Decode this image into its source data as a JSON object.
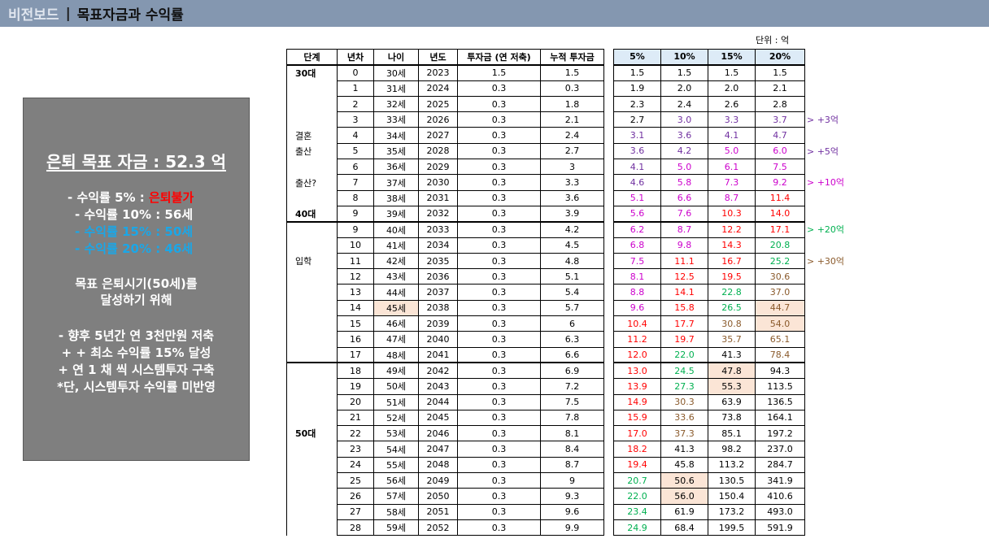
{
  "header": {
    "subtitle": "비전보드",
    "separator": "|",
    "title": "목표자금과 수익률"
  },
  "goal": {
    "title": "은퇴 목표 자금 : 52.3 억",
    "rates": [
      {
        "prefix": "- 수익률 5% : ",
        "value": "은퇴불가",
        "color": "red"
      },
      {
        "prefix": "- 수익률 10% : ",
        "value": "56세",
        "color": "white"
      },
      {
        "prefix": "- 수익률 15% : ",
        "value": "50세",
        "color": "blue"
      },
      {
        "prefix": "- 수익률 20% : ",
        "value": "46세",
        "color": "blue"
      }
    ],
    "target_line1": "목표 은퇴시기(50세)를",
    "target_line2": "달성하기 위해",
    "plan": [
      "- 향후 5년간 연 3천만원 저축",
      "+ + 최소 수익률 15% 달성",
      "+ 연 1 채 씩 시스템투자 구축",
      "*단, 시스템투자 수익률 미반영"
    ]
  },
  "unit": "단위 : 억",
  "colors": {
    "purple": "#7030a0",
    "magenta": "#cc00cc",
    "red": "#ff0000",
    "green": "#00b050",
    "brown": "#8a5a2b",
    "black": "#000000",
    "highlight": "#fbe5d6"
  },
  "table": {
    "headers": [
      "단계",
      "년차",
      "나이",
      "년도",
      "투자금 (연 저축)",
      "누적 투자금"
    ],
    "rate_headers": [
      "5%",
      "10%",
      "15%",
      "20%"
    ],
    "stages": [
      {
        "label": "30대",
        "row": 0,
        "bold": true
      },
      {
        "label": "결혼",
        "row": 4,
        "bold": false
      },
      {
        "label": "출산",
        "row": 5,
        "bold": false
      },
      {
        "label": "출산?",
        "row": 7,
        "bold": false
      },
      {
        "label": "40대",
        "row": 9,
        "bold": true
      },
      {
        "label": "입학",
        "row": 12,
        "bold": false
      },
      {
        "label": "50대",
        "row": 23,
        "bold": true
      }
    ],
    "rows": [
      {
        "year": "0",
        "age": "30세",
        "calyear": "2023",
        "invest": "1.5",
        "cum": "1.5",
        "r": [
          "1.5",
          "1.5",
          "1.5",
          "1.5"
        ],
        "c": [
          "black",
          "black",
          "black",
          "black"
        ]
      },
      {
        "year": "1",
        "age": "31세",
        "calyear": "2024",
        "invest": "0.3",
        "cum": "0.3",
        "r": [
          "1.9",
          "2.0",
          "2.0",
          "2.1"
        ],
        "c": [
          "black",
          "black",
          "black",
          "black"
        ]
      },
      {
        "year": "2",
        "age": "32세",
        "calyear": "2025",
        "invest": "0.3",
        "cum": "1.8",
        "r": [
          "2.3",
          "2.4",
          "2.6",
          "2.8"
        ],
        "c": [
          "black",
          "black",
          "black",
          "black"
        ]
      },
      {
        "year": "3",
        "age": "33세",
        "calyear": "2026",
        "invest": "0.3",
        "cum": "2.1",
        "r": [
          "2.7",
          "3.0",
          "3.3",
          "3.7"
        ],
        "c": [
          "black",
          "purple",
          "purple",
          "purple"
        ]
      },
      {
        "year": "4",
        "age": "34세",
        "calyear": "2027",
        "invest": "0.3",
        "cum": "2.4",
        "r": [
          "3.1",
          "3.6",
          "4.1",
          "4.7"
        ],
        "c": [
          "purple",
          "purple",
          "purple",
          "purple"
        ]
      },
      {
        "year": "5",
        "age": "35세",
        "calyear": "2028",
        "invest": "0.3",
        "cum": "2.7",
        "r": [
          "3.6",
          "4.2",
          "5.0",
          "6.0"
        ],
        "c": [
          "purple",
          "purple",
          "magenta",
          "magenta"
        ]
      },
      {
        "year": "6",
        "age": "36세",
        "calyear": "2029",
        "invest": "0.3",
        "cum": "3",
        "r": [
          "4.1",
          "5.0",
          "6.1",
          "7.5"
        ],
        "c": [
          "purple",
          "magenta",
          "magenta",
          "magenta"
        ]
      },
      {
        "year": "7",
        "age": "37세",
        "calyear": "2030",
        "invest": "0.3",
        "cum": "3.3",
        "r": [
          "4.6",
          "5.8",
          "7.3",
          "9.2"
        ],
        "c": [
          "purple",
          "magenta",
          "magenta",
          "magenta"
        ]
      },
      {
        "year": "8",
        "age": "38세",
        "calyear": "2031",
        "invest": "0.3",
        "cum": "3.6",
        "r": [
          "5.1",
          "6.6",
          "8.7",
          "11.4"
        ],
        "c": [
          "magenta",
          "magenta",
          "magenta",
          "red"
        ]
      },
      {
        "year": "9",
        "age": "39세",
        "calyear": "2032",
        "invest": "0.3",
        "cum": "3.9",
        "r": [
          "5.6",
          "7.6",
          "10.3",
          "14.0"
        ],
        "c": [
          "magenta",
          "magenta",
          "red",
          "red"
        ]
      },
      {
        "year": "9",
        "age": "40세",
        "calyear": "2033",
        "invest": "0.3",
        "cum": "4.2",
        "r": [
          "6.2",
          "8.7",
          "12.2",
          "17.1"
        ],
        "c": [
          "magenta",
          "magenta",
          "red",
          "red"
        ]
      },
      {
        "year": "10",
        "age": "41세",
        "calyear": "2034",
        "invest": "0.3",
        "cum": "4.5",
        "r": [
          "6.8",
          "9.8",
          "14.3",
          "20.8"
        ],
        "c": [
          "magenta",
          "magenta",
          "red",
          "green"
        ]
      },
      {
        "year": "11",
        "age": "42세",
        "calyear": "2035",
        "invest": "0.3",
        "cum": "4.8",
        "r": [
          "7.5",
          "11.1",
          "16.7",
          "25.2"
        ],
        "c": [
          "magenta",
          "red",
          "red",
          "green"
        ]
      },
      {
        "year": "12",
        "age": "43세",
        "calyear": "2036",
        "invest": "0.3",
        "cum": "5.1",
        "r": [
          "8.1",
          "12.5",
          "19.5",
          "30.6"
        ],
        "c": [
          "magenta",
          "red",
          "red",
          "brown"
        ]
      },
      {
        "year": "13",
        "age": "44세",
        "calyear": "2037",
        "invest": "0.3",
        "cum": "5.4",
        "r": [
          "8.8",
          "14.1",
          "22.8",
          "37.0"
        ],
        "c": [
          "magenta",
          "red",
          "green",
          "brown"
        ]
      },
      {
        "year": "14",
        "age": "45세",
        "calyear": "2038",
        "invest": "0.3",
        "cum": "5.7",
        "r": [
          "9.6",
          "15.8",
          "26.5",
          "44.7"
        ],
        "c": [
          "magenta",
          "red",
          "green",
          "brown"
        ]
      },
      {
        "year": "15",
        "age": "46세",
        "calyear": "2039",
        "invest": "0.3",
        "cum": "6",
        "r": [
          "10.4",
          "17.7",
          "30.8",
          "54.0"
        ],
        "c": [
          "red",
          "red",
          "brown",
          "brown"
        ]
      },
      {
        "year": "16",
        "age": "47세",
        "calyear": "2040",
        "invest": "0.3",
        "cum": "6.3",
        "r": [
          "11.2",
          "19.7",
          "35.7",
          "65.1"
        ],
        "c": [
          "red",
          "red",
          "brown",
          "brown"
        ]
      },
      {
        "year": "17",
        "age": "48세",
        "calyear": "2041",
        "invest": "0.3",
        "cum": "6.6",
        "r": [
          "12.0",
          "22.0",
          "41.3",
          "78.4"
        ],
        "c": [
          "red",
          "green",
          "black",
          "brown"
        ]
      },
      {
        "year": "18",
        "age": "49세",
        "calyear": "2042",
        "invest": "0.3",
        "cum": "6.9",
        "r": [
          "13.0",
          "24.5",
          "47.8",
          "94.3"
        ],
        "c": [
          "red",
          "green",
          "black",
          "black"
        ]
      },
      {
        "year": "19",
        "age": "50세",
        "calyear": "2043",
        "invest": "0.3",
        "cum": "7.2",
        "r": [
          "13.9",
          "27.3",
          "55.3",
          "113.5"
        ],
        "c": [
          "red",
          "green",
          "black",
          "black"
        ]
      },
      {
        "year": "20",
        "age": "51세",
        "calyear": "2044",
        "invest": "0.3",
        "cum": "7.5",
        "r": [
          "14.9",
          "30.3",
          "63.9",
          "136.5"
        ],
        "c": [
          "red",
          "brown",
          "black",
          "black"
        ]
      },
      {
        "year": "21",
        "age": "52세",
        "calyear": "2045",
        "invest": "0.3",
        "cum": "7.8",
        "r": [
          "15.9",
          "33.6",
          "73.8",
          "164.1"
        ],
        "c": [
          "red",
          "brown",
          "black",
          "black"
        ]
      },
      {
        "year": "22",
        "age": "53세",
        "calyear": "2046",
        "invest": "0.3",
        "cum": "8.1",
        "r": [
          "17.0",
          "37.3",
          "85.1",
          "197.2"
        ],
        "c": [
          "red",
          "brown",
          "black",
          "black"
        ]
      },
      {
        "year": "23",
        "age": "54세",
        "calyear": "2047",
        "invest": "0.3",
        "cum": "8.4",
        "r": [
          "18.2",
          "41.3",
          "98.2",
          "237.0"
        ],
        "c": [
          "red",
          "black",
          "black",
          "black"
        ]
      },
      {
        "year": "24",
        "age": "55세",
        "calyear": "2048",
        "invest": "0.3",
        "cum": "8.7",
        "r": [
          "19.4",
          "45.8",
          "113.2",
          "284.7"
        ],
        "c": [
          "red",
          "black",
          "black",
          "black"
        ]
      },
      {
        "year": "25",
        "age": "56세",
        "calyear": "2049",
        "invest": "0.3",
        "cum": "9",
        "r": [
          "20.7",
          "50.6",
          "130.5",
          "341.9"
        ],
        "c": [
          "green",
          "black",
          "black",
          "black"
        ]
      },
      {
        "year": "26",
        "age": "57세",
        "calyear": "2050",
        "invest": "0.3",
        "cum": "9.3",
        "r": [
          "22.0",
          "56.0",
          "150.4",
          "410.6"
        ],
        "c": [
          "green",
          "black",
          "black",
          "black"
        ]
      },
      {
        "year": "27",
        "age": "58세",
        "calyear": "2051",
        "invest": "0.3",
        "cum": "9.6",
        "r": [
          "23.4",
          "61.9",
          "173.2",
          "493.0"
        ],
        "c": [
          "green",
          "black",
          "black",
          "black"
        ]
      },
      {
        "year": "28",
        "age": "59세",
        "calyear": "2052",
        "invest": "0.3",
        "cum": "9.9",
        "r": [
          "24.9",
          "68.4",
          "199.5",
          "591.9"
        ],
        "c": [
          "green",
          "black",
          "black",
          "black"
        ]
      }
    ],
    "highlights": {
      "age_rows": [
        15
      ],
      "rate_cells": [
        [
          15,
          3
        ],
        [
          16,
          3
        ],
        [
          19,
          2
        ],
        [
          20,
          2
        ],
        [
          26,
          1
        ],
        [
          27,
          1
        ]
      ]
    },
    "group_starts": [
      10,
      19
    ]
  },
  "notes": [
    {
      "text": "> +3억",
      "row": 3,
      "color": "purple"
    },
    {
      "text": "> +5억",
      "row": 5,
      "color": "purple"
    },
    {
      "text": "> +10억",
      "row": 7,
      "color": "magenta"
    },
    {
      "text": "> +20억",
      "row": 10,
      "color": "green"
    },
    {
      "text": "> +30억",
      "row": 12,
      "color": "brown"
    }
  ]
}
